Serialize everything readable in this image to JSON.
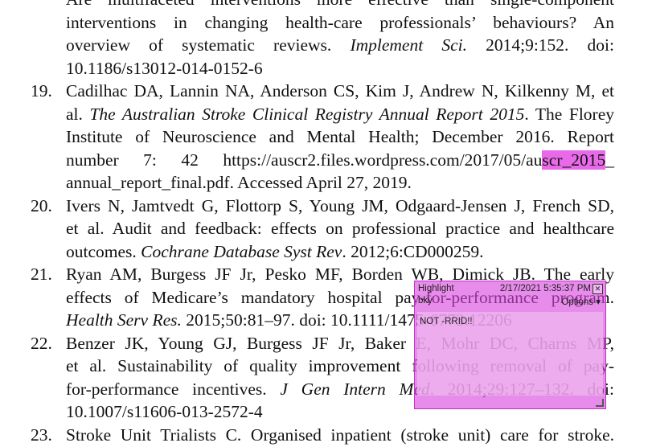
{
  "references": [
    {
      "num": "",
      "lines": [
        "Are multifaceted interventions more effective than single-component",
        "interventions in changing health-care professionals’ behaviours? An",
        "overview of systematic reviews. Implement Sci. 2014;9:152. doi:",
        "10.1186/s13012-014-0152-6"
      ]
    },
    {
      "num": "19.",
      "lines": [
        "Cadilhac DA, Lannin NA, Anderson CS, Kim J, Andrew N, Kilkenny M, et",
        "al. The Australian Stroke Clinical Registry Annual Report 2015. The Florey",
        "Institute of Neuroscience and Mental Health; December 2016. Report",
        "number 7: 42 https://auscr2.files.wordpress.com/2017/05/auscr_2015_",
        "annual_report_final.pdf. Accessed April 27, 2019."
      ]
    },
    {
      "num": "20.",
      "lines": [
        "Ivers N, Jamtvedt G, Flottorp S, Young JM, Odgaard-Jensen J, French SD,",
        "et al. Audit and feedback: effects on professional practice and healthcare",
        "outcomes. Cochrane Database Syst Rev. 2012;6:CD000259."
      ]
    },
    {
      "num": "21.",
      "lines": [
        "Ryan AM, Burgess JF Jr, Pesko MF, Borden WB, Dimick JB. The early",
        "effects of Medicare’s mandatory hospital pay-for-performance program.",
        "Health Serv Res. 2015;50:81–97. doi: 10.1111/1475-6773.12206"
      ]
    },
    {
      "num": "22.",
      "lines": [
        "Benzer JK, Young GJ, Burgess JF Jr, Baker E, Mohr DC, Charns MP,",
        "et al. Sustainability of quality improvement following removal of pay-",
        "for-performance incentives. J Gen Intern Med. 2014;29:127–132. doi:",
        "10.1007/s11606-013-2572-4"
      ]
    },
    {
      "num": "23.",
      "lines": [
        "Stroke Unit Trialists C. Organised inpatient (stroke unit) care for stroke."
      ]
    }
  ],
  "highlight_text": "scr_2015",
  "annotation": {
    "title": "Highlight",
    "datetime": "2/17/2021 5:35:37 PM",
    "author": "bky",
    "options_label": "Options",
    "body": "NOT -RRID!!",
    "highlight_color": "#e86ae8",
    "note_color": "#d946dd"
  }
}
